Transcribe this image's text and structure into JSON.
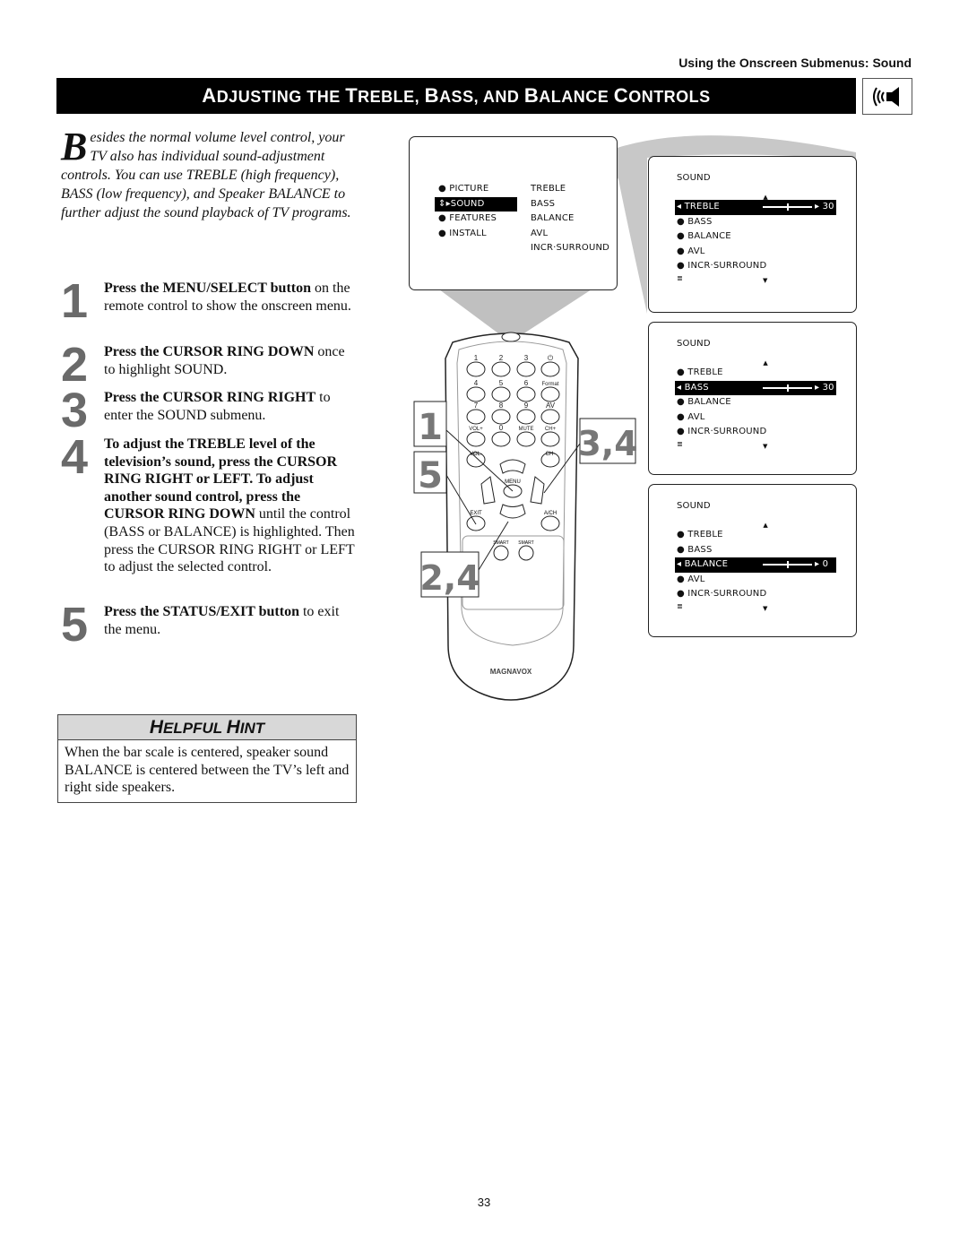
{
  "running_head": "Using the Onscreen Submenus: Sound",
  "title": {
    "parts": [
      {
        "cap": "A",
        "rest": "DJUSTING THE "
      },
      {
        "cap": "T",
        "rest": "REBLE, "
      },
      {
        "cap": "B",
        "rest": "ASS, AND "
      },
      {
        "cap": "B",
        "rest": "ALANCE "
      },
      {
        "cap": "C",
        "rest": "ONTROLS"
      }
    ],
    "icon": "speaker-sound-icon"
  },
  "intro": {
    "dropcap": "B",
    "text": "esides the normal volume level control, your TV also has individual sound-adjustment controls. You can use TREBLE (high frequency), BASS (low frequency), and Speaker BALANCE to further adjust the sound playback of TV programs."
  },
  "steps": [
    {
      "num": "1",
      "bold": "Press the MENU/SELECT button",
      "text": " on the remote control to show the onscreen menu."
    },
    {
      "num": "2",
      "bold": "Press the CURSOR RING DOWN",
      "text": " once to highlight SOUND."
    },
    {
      "num": "3",
      "bold": "Press the CURSOR RING RIGHT",
      "text": " to enter the SOUND submenu."
    },
    {
      "num": "4",
      "bold": "To adjust the TREBLE level of the television’s sound, press the CURSOR RING RIGHT or LEFT. To adjust another sound control, press the CURSOR RING DOWN",
      "text": " until the control (BASS or BALANCE) is highlighted. Then press the CURSOR RING RIGHT or LEFT to adjust the selected control."
    },
    {
      "num": "5",
      "bold": "Press the STATUS/EXIT button",
      "text": " to exit the menu."
    }
  ],
  "hint": {
    "title_cap1": "H",
    "title_rest1": "ELPFUL ",
    "title_cap2": "H",
    "title_rest2": "INT",
    "text": "When the bar scale is centered, speaker sound BALANCE is centered between the TV’s left and right side speakers."
  },
  "main_menu": {
    "left": [
      "PICTURE",
      "SOUND",
      "FEATURES",
      "INSTALL"
    ],
    "selected_index": 1,
    "right": [
      "TREBLE",
      "BASS",
      "BALANCE",
      "AVL",
      "INCR·SURROUND"
    ]
  },
  "sound_menus": [
    {
      "title": "SOUND",
      "items": [
        "TREBLE",
        "BASS",
        "BALANCE",
        "AVL",
        "INCR·SURROUND"
      ],
      "selected_index": 0,
      "value": "30",
      "slider_fraction": 0.5
    },
    {
      "title": "SOUND",
      "items": [
        "TREBLE",
        "BASS",
        "BALANCE",
        "AVL",
        "INCR·SURROUND"
      ],
      "selected_index": 1,
      "value": "30",
      "slider_fraction": 0.5
    },
    {
      "title": "SOUND",
      "items": [
        "TREBLE",
        "BASS",
        "BALANCE",
        "AVL",
        "INCR·SURROUND"
      ],
      "selected_index": 2,
      "value": "0",
      "slider_fraction": 0.5
    }
  ],
  "remote": {
    "brand": "MAGNAVOX",
    "rows": [
      [
        "1",
        "2",
        "3",
        "⏻"
      ],
      [
        "4",
        "5",
        "6",
        "Format"
      ],
      [
        "7",
        "8",
        "9",
        "AV"
      ],
      [
        "VOL+",
        "0",
        "MUTE",
        "CH+"
      ]
    ],
    "labels": {
      "vol_minus": "VOL-",
      "ch_minus": "CH-",
      "menu": "MENU",
      "exit": "EXIT",
      "ach": "A/CH",
      "smart1": "SMART",
      "smart2": "SMART"
    },
    "callouts": [
      "1",
      "5",
      "3,4",
      "2,4"
    ]
  },
  "page_number": "33"
}
